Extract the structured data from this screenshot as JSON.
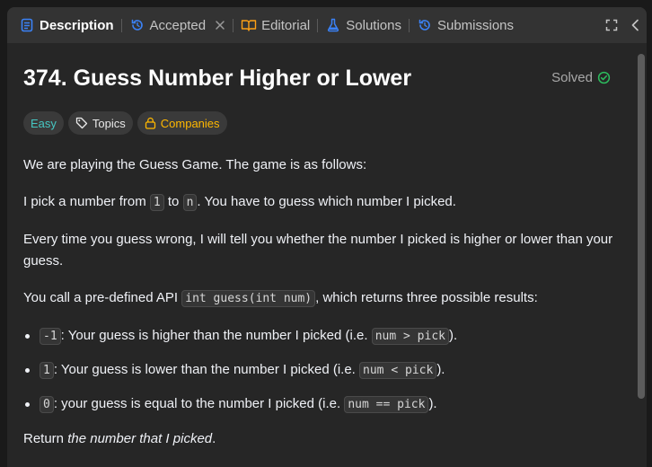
{
  "tabs": {
    "description": "Description",
    "accepted": "Accepted",
    "editorial": "Editorial",
    "solutions": "Solutions",
    "submissions": "Submissions"
  },
  "problem": {
    "title": "374. Guess Number Higher or Lower",
    "status": "Solved",
    "tags": {
      "difficulty": "Easy",
      "topics": "Topics",
      "companies": "Companies"
    }
  },
  "description": {
    "p1": "We are playing the Guess Game. The game is as follows:",
    "p2": {
      "a": "I pick a number from ",
      "code1": "1",
      "b": " to ",
      "code2": "n",
      "c": ". You have to guess which number I picked."
    },
    "p3": "Every time you guess wrong, I will tell you whether the number I picked is higher or lower than your guess.",
    "p4": {
      "a": "You call a pre-defined API ",
      "code": "int guess(int num)",
      "b": ", which returns three possible results:"
    },
    "results": [
      {
        "code": "-1",
        "text": ": Your guess is higher than the number I picked (i.e. ",
        "code2": "num > pick",
        "end": ")."
      },
      {
        "code": "1",
        "text": ": Your guess is lower than the number I picked (i.e. ",
        "code2": "num < pick",
        "end": ")."
      },
      {
        "code": "0",
        "text": ": your guess is equal to the number I picked (i.e. ",
        "code2": "num == pick",
        "end": ")."
      }
    ],
    "p5": {
      "a": "Return ",
      "em": "the number that I picked",
      "b": "."
    }
  },
  "colors": {
    "easy": "#46c6c2",
    "companies": "#ffb800",
    "solved_check": "#2cbb5d",
    "accent_blue": "#3b82f6"
  },
  "icons": [
    "description-icon",
    "history-icon",
    "close-icon",
    "book-icon",
    "flask-icon",
    "clock-icon",
    "expand-icon",
    "chevron-left-icon",
    "check-circle-icon",
    "tag-icon",
    "lock-icon"
  ]
}
